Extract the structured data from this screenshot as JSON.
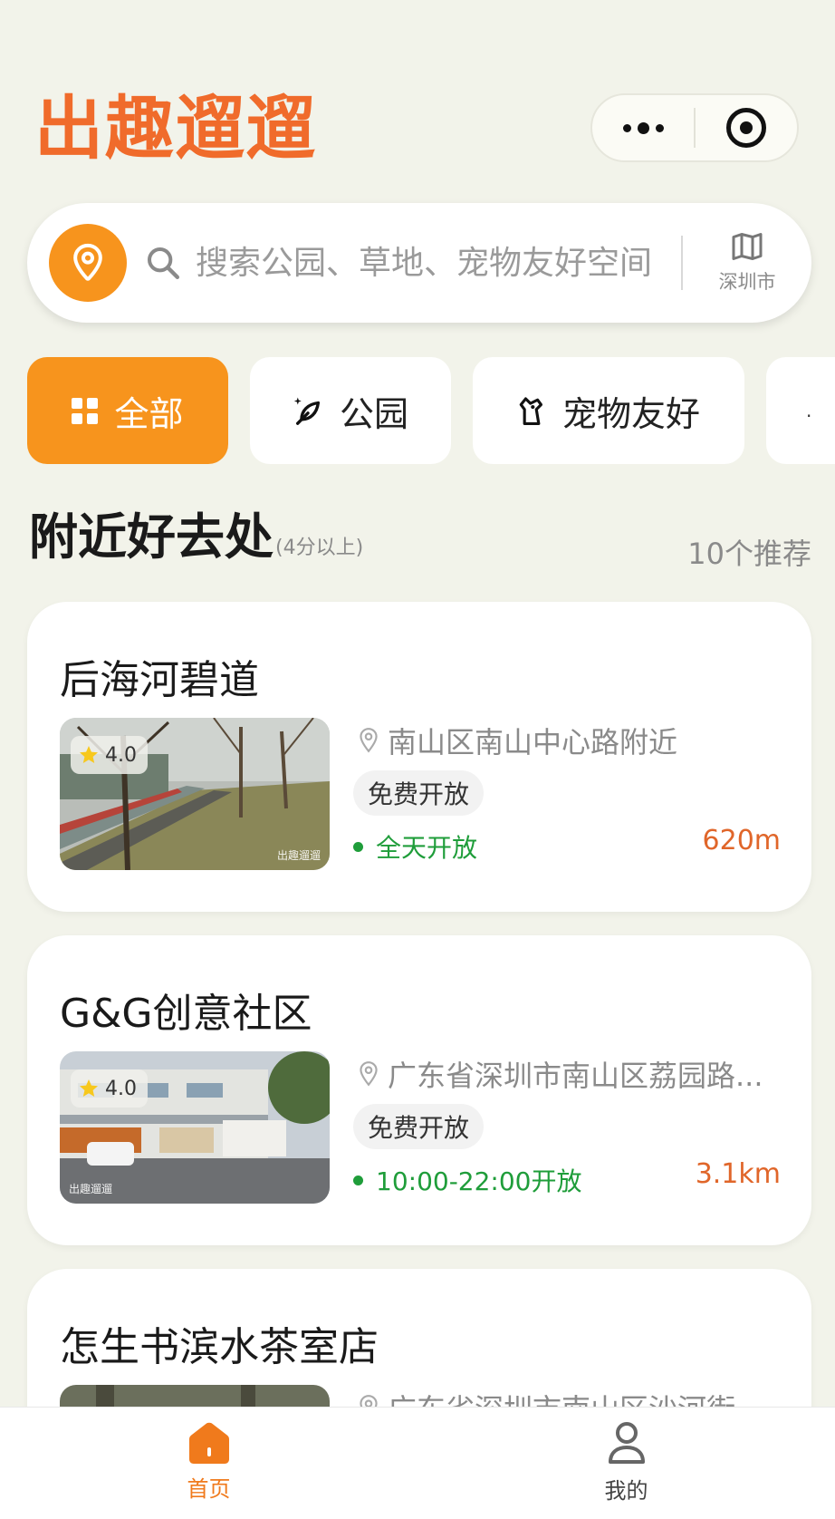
{
  "header": {
    "app_title": "出趣遛遛",
    "capsule": {
      "more_icon": "more-dots-icon",
      "close_icon": "target-circle-icon"
    }
  },
  "search": {
    "location_icon": "location-pin-icon",
    "placeholder": "搜索公园、草地、宠物友好空间",
    "city": "深圳市",
    "map_icon": "map-icon"
  },
  "categories": [
    {
      "label": "全部",
      "icon": "grid-icon",
      "active": true
    },
    {
      "label": "公园",
      "icon": "leaf-icon",
      "active": false
    },
    {
      "label": "宠物友好",
      "icon": "pet-icon",
      "active": false
    }
  ],
  "section": {
    "title": "附近好去处",
    "subtitle": "(4分以上)",
    "count": "10个推荐"
  },
  "places": [
    {
      "name": "后海河碧道",
      "rating": "4.0",
      "address": "南山区南山中心路附近",
      "tag": "免费开放",
      "hours": "全天开放",
      "distance": "620m",
      "watermark": "出趣遛遛"
    },
    {
      "name": "G&G创意社区",
      "rating": "4.0",
      "address": "广东省深圳市南山区荔园路...",
      "tag": "免费开放",
      "hours": "10:00-22:00开放",
      "distance": "3.1km",
      "watermark": "出趣遛遛"
    },
    {
      "name": "怎生书滨水茶室店",
      "address": "广东省深圳市南山区沙河街"
    }
  ],
  "tabbar": {
    "home": {
      "label": "首页",
      "icon": "home-icon",
      "active": true
    },
    "me": {
      "label": "我的",
      "icon": "user-icon",
      "active": false
    }
  },
  "colors": {
    "brand_orange": "#f06b2b",
    "accent_orange": "#f7941d",
    "open_green": "#1f9d3a",
    "distance_orange": "#e0662a",
    "background": "#f2f3ea"
  }
}
